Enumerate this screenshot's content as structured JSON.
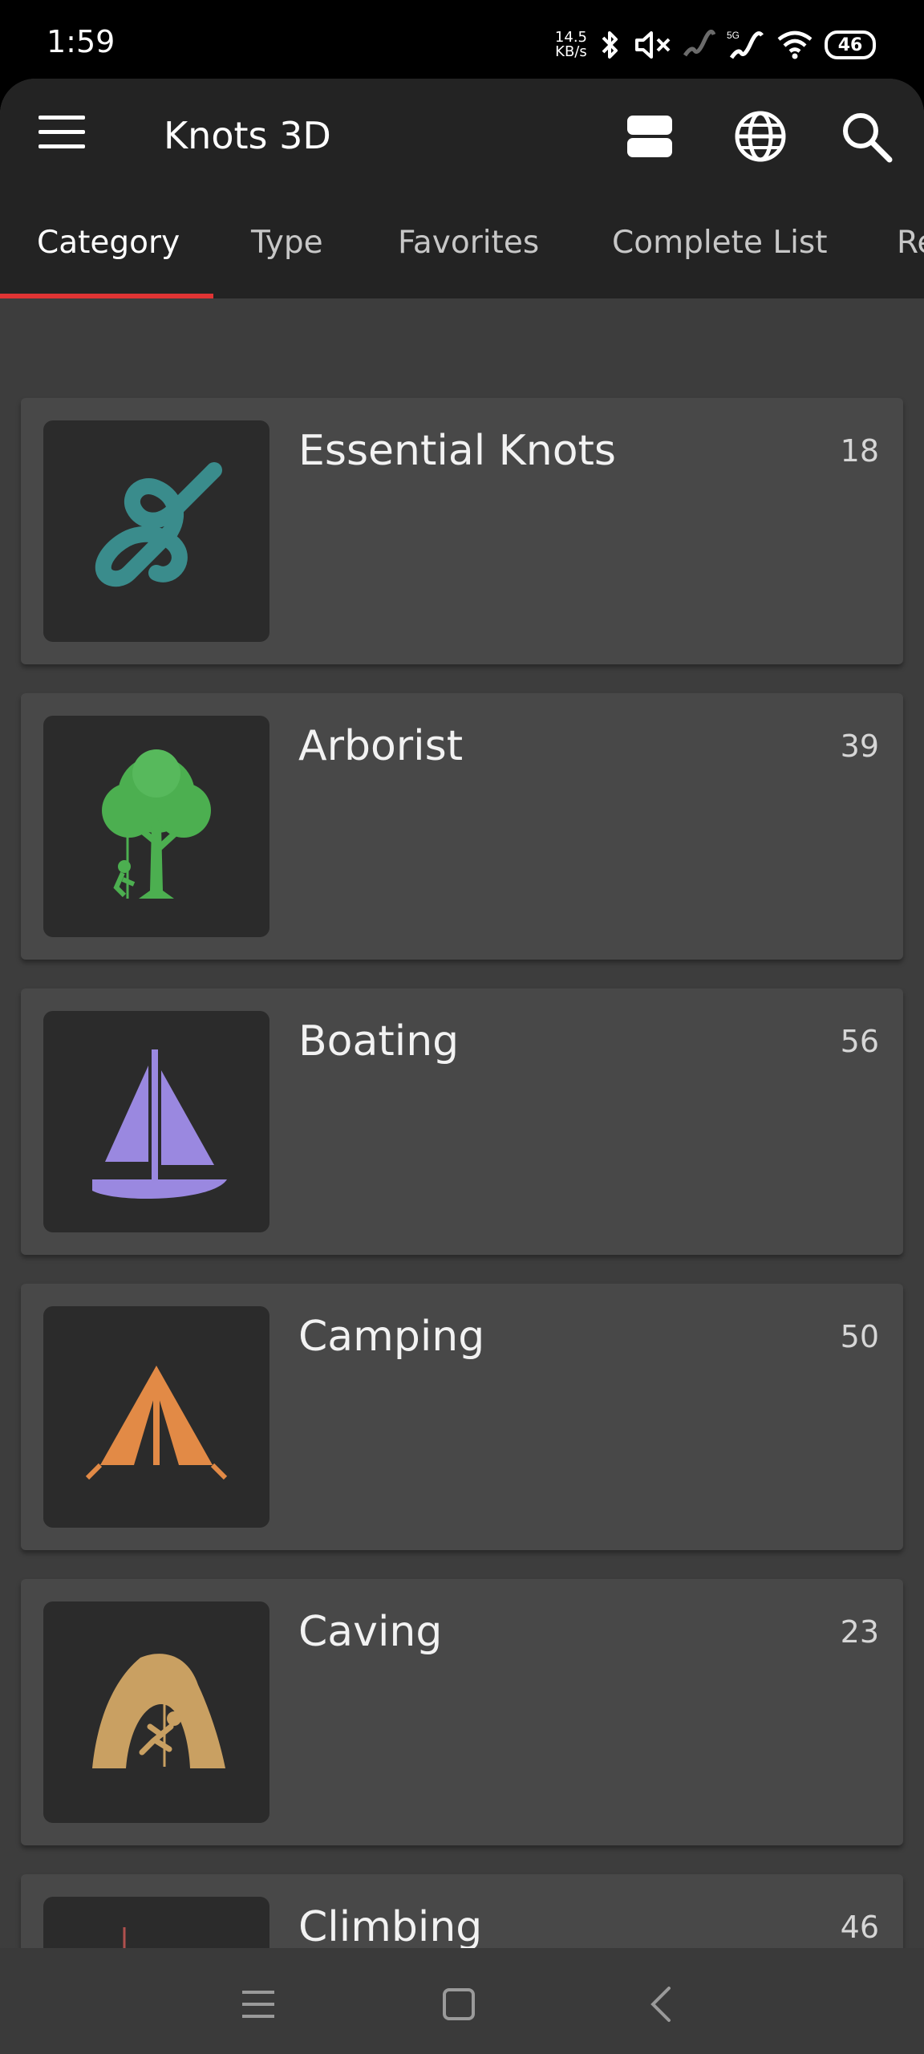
{
  "status_bar": {
    "time": "1:59",
    "net_speed_value": "14.5",
    "net_speed_unit": "KB/s",
    "battery": "46",
    "icons": [
      "bluetooth-icon",
      "mute-icon",
      "signal-icon",
      "5g-signal-icon",
      "wifi-icon",
      "battery-icon"
    ]
  },
  "app": {
    "title": "Knots 3D",
    "actions": [
      "view-toggle-icon",
      "globe-icon",
      "search-icon"
    ]
  },
  "tabs": [
    {
      "label": "Category",
      "active": true
    },
    {
      "label": "Type",
      "active": false
    },
    {
      "label": "Favorites",
      "active": false
    },
    {
      "label": "Complete List",
      "active": false
    },
    {
      "label": "Re",
      "active": false
    }
  ],
  "categories": [
    {
      "name": "Essential Knots",
      "count": "18",
      "icon": "figure-eight-knot-icon",
      "color": "#3a8c8c"
    },
    {
      "name": "Arborist",
      "count": "39",
      "icon": "tree-climber-icon",
      "color": "#4caf50"
    },
    {
      "name": "Boating",
      "count": "56",
      "icon": "sailboat-icon",
      "color": "#9a88e0"
    },
    {
      "name": "Camping",
      "count": "50",
      "icon": "tent-icon",
      "color": "#e28a46"
    },
    {
      "name": "Caving",
      "count": "23",
      "icon": "cave-climber-icon",
      "color": "#c9a062"
    },
    {
      "name": "Climbing",
      "count": "46",
      "icon": "rock-climber-icon",
      "color": "#b0504e"
    }
  ],
  "nav": [
    "recents-icon",
    "home-icon",
    "back-icon"
  ],
  "colors": {
    "accent": "#e03434",
    "app_bar": "#232323",
    "card": "#484848"
  }
}
